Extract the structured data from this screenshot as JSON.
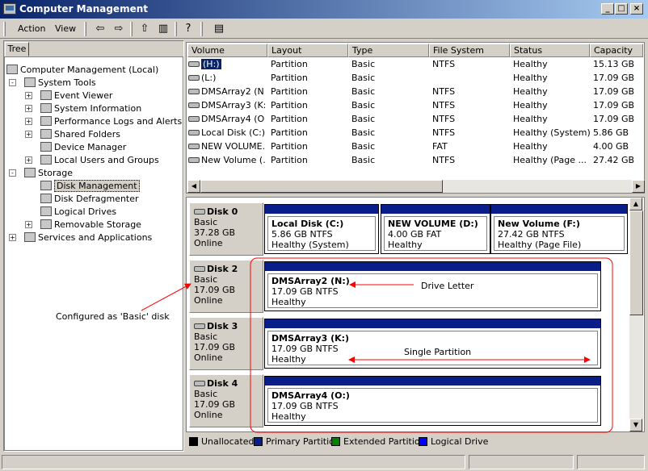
{
  "window": {
    "title": "Computer Management",
    "controls": {
      "minimize": "_",
      "maximize": "□",
      "close": "×"
    }
  },
  "menu": {
    "action": "Action",
    "view": "View"
  },
  "toolbar": {
    "icons": [
      "back-arrow-icon",
      "forward-arrow-icon",
      "up-folder-icon",
      "show-hide-tree-icon",
      "help-icon",
      "properties-icon"
    ],
    "glyphs": {
      "back": "⇦",
      "forward": "⇨",
      "up": "⇧",
      "tree": "▥",
      "help": "?",
      "props": "▤"
    }
  },
  "tree": {
    "tab_label": "Tree",
    "items": [
      {
        "label": "Computer Management (Local)",
        "level": 0,
        "expander": ""
      },
      {
        "label": "System Tools",
        "level": 1,
        "expander": "-"
      },
      {
        "label": "Event Viewer",
        "level": 2,
        "expander": "+"
      },
      {
        "label": "System Information",
        "level": 2,
        "expander": "+"
      },
      {
        "label": "Performance Logs and Alerts",
        "level": 2,
        "expander": "+"
      },
      {
        "label": "Shared Folders",
        "level": 2,
        "expander": "+"
      },
      {
        "label": "Device Manager",
        "level": 2,
        "expander": ""
      },
      {
        "label": "Local Users and Groups",
        "level": 2,
        "expander": "+"
      },
      {
        "label": "Storage",
        "level": 1,
        "expander": "-"
      },
      {
        "label": "Disk Management",
        "level": 2,
        "expander": "",
        "selected": true
      },
      {
        "label": "Disk Defragmenter",
        "level": 2,
        "expander": ""
      },
      {
        "label": "Logical Drives",
        "level": 2,
        "expander": ""
      },
      {
        "label": "Removable Storage",
        "level": 2,
        "expander": "+"
      },
      {
        "label": "Services and Applications",
        "level": 1,
        "expander": "+"
      }
    ]
  },
  "volume_list": {
    "columns": [
      "Volume",
      "Layout",
      "Type",
      "File System",
      "Status",
      "Capacity"
    ],
    "rows": [
      {
        "volume": "(H:)",
        "layout": "Partition",
        "type": "Basic",
        "fs": "NTFS",
        "status": "Healthy",
        "capacity": "15.13 GB",
        "selected": true
      },
      {
        "volume": "(L:)",
        "layout": "Partition",
        "type": "Basic",
        "fs": "",
        "status": "Healthy",
        "capacity": "17.09 GB"
      },
      {
        "volume": "DMSArray2 (N:)",
        "layout": "Partition",
        "type": "Basic",
        "fs": "NTFS",
        "status": "Healthy",
        "capacity": "17.09 GB"
      },
      {
        "volume": "DMSArray3 (K:)",
        "layout": "Partition",
        "type": "Basic",
        "fs": "NTFS",
        "status": "Healthy",
        "capacity": "17.09 GB"
      },
      {
        "volume": "DMSArray4 (O:)",
        "layout": "Partition",
        "type": "Basic",
        "fs": "NTFS",
        "status": "Healthy",
        "capacity": "17.09 GB"
      },
      {
        "volume": "Local Disk (C:)",
        "layout": "Partition",
        "type": "Basic",
        "fs": "NTFS",
        "status": "Healthy (System)",
        "capacity": "5.86 GB"
      },
      {
        "volume": "NEW VOLUME...",
        "layout": "Partition",
        "type": "Basic",
        "fs": "FAT",
        "status": "Healthy",
        "capacity": "4.00 GB"
      },
      {
        "volume": "New Volume (...",
        "layout": "Partition",
        "type": "Basic",
        "fs": "NTFS",
        "status": "Healthy (Page ...",
        "capacity": "27.42 GB"
      }
    ]
  },
  "disks": [
    {
      "name": "Disk 0",
      "type": "Basic",
      "size": "37.28 GB",
      "status": "Online",
      "volumes": [
        {
          "name": "Local Disk  (C:)",
          "size": "5.86 GB NTFS",
          "status": "Healthy (System)"
        },
        {
          "name": "NEW VOLUME  (D:)",
          "size": "4.00 GB FAT",
          "status": "Healthy"
        },
        {
          "name": "New Volume  (F:)",
          "size": "27.42 GB NTFS",
          "status": "Healthy (Page File)"
        }
      ]
    },
    {
      "name": "Disk 2",
      "type": "Basic",
      "size": "17.09 GB",
      "status": "Online",
      "volumes": [
        {
          "name": "DMSArray2  (N:)",
          "size": "17.09 GB NTFS",
          "status": "Healthy"
        }
      ]
    },
    {
      "name": "Disk 3",
      "type": "Basic",
      "size": "17.09 GB",
      "status": "Online",
      "volumes": [
        {
          "name": "DMSArray3  (K:)",
          "size": "17.09 GB NTFS",
          "status": "Healthy"
        }
      ]
    },
    {
      "name": "Disk 4",
      "type": "Basic",
      "size": "17.09 GB",
      "status": "Online",
      "volumes": [
        {
          "name": "DMSArray4  (O:)",
          "size": "17.09 GB NTFS",
          "status": "Healthy"
        }
      ]
    }
  ],
  "legend": [
    {
      "label": "Unallocated",
      "color": "#000000"
    },
    {
      "label": "Primary Partition",
      "color": "#0a1e8a"
    },
    {
      "label": "Extended Partition",
      "color": "#008000"
    },
    {
      "label": "Logical Drive",
      "color": "#0000ff"
    }
  ],
  "annotations": {
    "drive_letter": "Drive Letter",
    "single_partition": "Single Partition",
    "configured_basic": "Configured as 'Basic' disk",
    "color": "#ff0000"
  }
}
